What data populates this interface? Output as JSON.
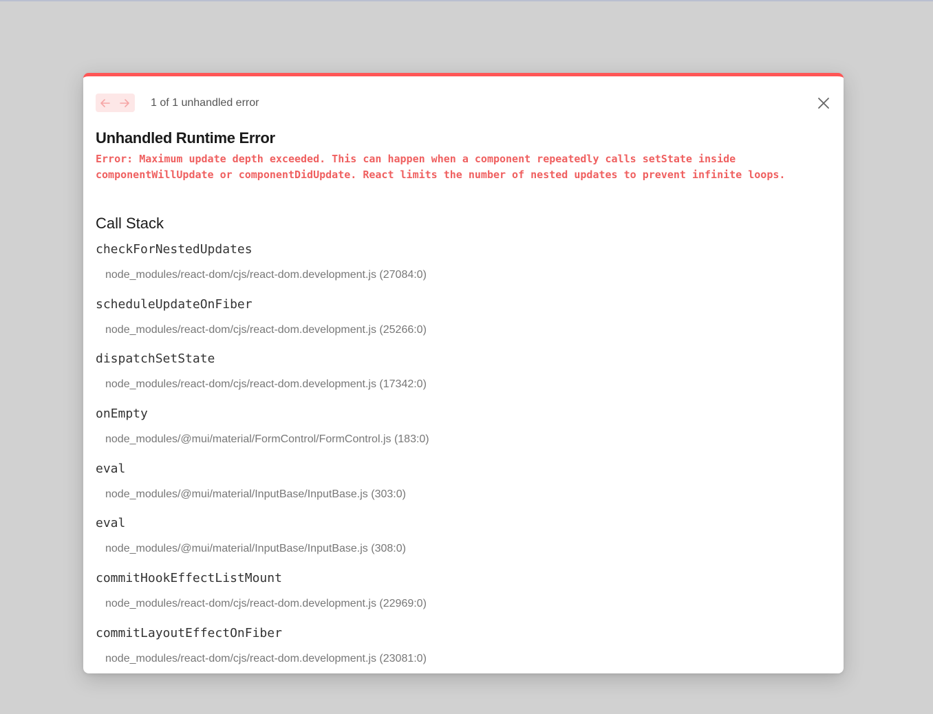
{
  "header": {
    "prev_icon": "arrow-left-icon",
    "next_icon": "arrow-right-icon",
    "error_count": "1 of 1 unhandled error",
    "close_icon": "close-icon"
  },
  "title": "Unhandled Runtime Error",
  "error_message": "Error: Maximum update depth exceeded. This can happen when a component repeatedly calls setState inside componentWillUpdate or componentDidUpdate. React limits the number of nested updates to prevent infinite loops.",
  "call_stack": {
    "title": "Call Stack",
    "frames": [
      {
        "fn": "checkForNestedUpdates",
        "file": "node_modules/react-dom/cjs/react-dom.development.js (27084:0)"
      },
      {
        "fn": "scheduleUpdateOnFiber",
        "file": "node_modules/react-dom/cjs/react-dom.development.js (25266:0)"
      },
      {
        "fn": "dispatchSetState",
        "file": "node_modules/react-dom/cjs/react-dom.development.js (17342:0)"
      },
      {
        "fn": "onEmpty",
        "file": "node_modules/@mui/material/FormControl/FormControl.js (183:0)"
      },
      {
        "fn": "eval",
        "file": "node_modules/@mui/material/InputBase/InputBase.js (303:0)"
      },
      {
        "fn": "eval",
        "file": "node_modules/@mui/material/InputBase/InputBase.js (308:0)"
      },
      {
        "fn": "commitHookEffectListMount",
        "file": "node_modules/react-dom/cjs/react-dom.development.js (22969:0)"
      },
      {
        "fn": "commitLayoutEffectOnFiber",
        "file": "node_modules/react-dom/cjs/react-dom.development.js (23081:0)"
      }
    ]
  },
  "colors": {
    "accent": "#ff5555",
    "error_text": "#ef5f5f",
    "nav_bg": "#fde7e7",
    "overlay_bg": "#d1d1d1"
  }
}
